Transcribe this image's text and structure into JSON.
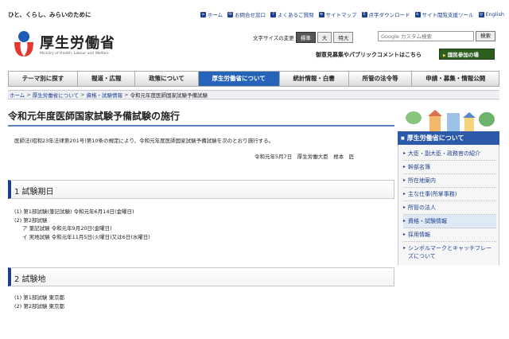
{
  "header": {
    "tagline": "ひと、くらし、みらいのために",
    "utility_links": [
      {
        "label": "ホーム",
        "icon": "home-icon"
      },
      {
        "label": "お問合せ窓口",
        "icon": "mail-icon"
      },
      {
        "label": "よくあるご質問",
        "icon": "question-icon"
      },
      {
        "label": "サイトマップ",
        "icon": "sitemap-icon"
      },
      {
        "label": "点字ダウンロード",
        "icon": "braille-icon"
      },
      {
        "label": "サイト閲覧支援ツール",
        "icon": "accessibility-icon"
      },
      {
        "label": "English",
        "icon": "globe-icon"
      }
    ],
    "logo_title": "厚生労働省",
    "logo_subtitle": "Ministry of Health, Labour and Welfare",
    "font_size_label": "文字サイズの変更",
    "font_sizes": [
      "標準",
      "大",
      "特大"
    ],
    "search_placeholder": "Google カスタム検索",
    "search_button": "検索",
    "pubcom_text": "御意見募集やパブリックコメントはこちら",
    "participate_button": "国民参加の場"
  },
  "nav": {
    "tabs": [
      "テーマ別に探す",
      "報道・広報",
      "政策について",
      "厚生労働省について",
      "統計情報・白書",
      "所管の法令等",
      "申請・募集・情報公開"
    ],
    "active_index": 3
  },
  "breadcrumb": {
    "items": [
      "ホーム",
      "厚生労働省について",
      "資格・試験情報"
    ],
    "current": "令和元年度医師国家試験予備試験"
  },
  "main": {
    "title": "令和元年度医師国家試験予備試験の施行",
    "lead": "医師法(昭和23年法律第201号)第10条の規定により、令和元年度医師国家試験予備試験を次のとおり施行する。",
    "signature": "令和元年5月7日　厚生労働大臣　根本　匠",
    "section1": {
      "title": "1  試験期日",
      "lines": [
        "(1)  第1部試験(筆記試験)  令和元年6月14日(金曜日)",
        "(2)  第2部試験",
        "ア  筆記試験  令和元年9月20日(金曜日)",
        "イ  実地試験  令和元年11月5日(火曜日)又は6日(水曜日)"
      ]
    },
    "section2": {
      "title": "2  試験地",
      "lines": [
        "(1)  第1部試験  東京都",
        "(2)  第2部試験  東京都"
      ]
    }
  },
  "sidebar": {
    "heading": "厚生労働省について",
    "items": [
      "大臣・副大臣・政務官の紹介",
      "幹部名簿",
      "所在地案内",
      "主な仕事(所掌事務)",
      "所管の法人",
      "資格・試験情報",
      "採用情報",
      "シンボルマークとキャッチフレーズについて"
    ],
    "selected_index": 5
  },
  "colors": {
    "brand_blue": "#1a3f8f",
    "nav_active": "#2564b8",
    "participate_green": "#2d5e1e",
    "logo_red": "#e6372d",
    "logo_blue": "#1d5db8"
  }
}
